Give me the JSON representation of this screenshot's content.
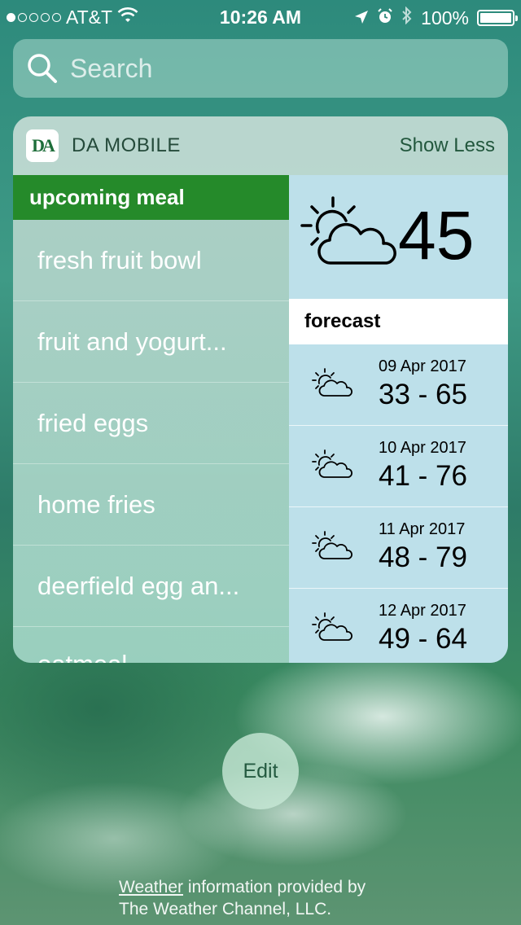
{
  "status_bar": {
    "carrier": "AT&T",
    "time": "10:26 AM",
    "battery": "100%",
    "signal_bars_filled": 1,
    "signal_bars_total": 5
  },
  "search": {
    "placeholder": "Search"
  },
  "widget": {
    "app_name": "DA MOBILE",
    "app_icon_text": "DA",
    "show_less_label": "Show Less",
    "meal": {
      "header": "upcoming meal",
      "items": [
        "fresh fruit bowl",
        "fruit and yogurt...",
        "fried eggs",
        "home fries",
        "deerfield egg an...",
        "oatmeal"
      ]
    },
    "weather": {
      "current_temp": "45",
      "forecast_header": "forecast",
      "forecast": [
        {
          "date": "09 Apr 2017",
          "range": "33 - 65"
        },
        {
          "date": "10 Apr 2017",
          "range": "41 - 76"
        },
        {
          "date": "11 Apr 2017",
          "range": "48 - 79"
        },
        {
          "date": "12 Apr 2017",
          "range": "49 - 64"
        }
      ]
    }
  },
  "edit_label": "Edit",
  "footer": {
    "link": "Weather",
    "line1_rest": " information provided by",
    "line2": "The Weather Channel, LLC."
  },
  "colors": {
    "meal_header": "#258a2a",
    "weather_bg": "#bde0ea"
  }
}
